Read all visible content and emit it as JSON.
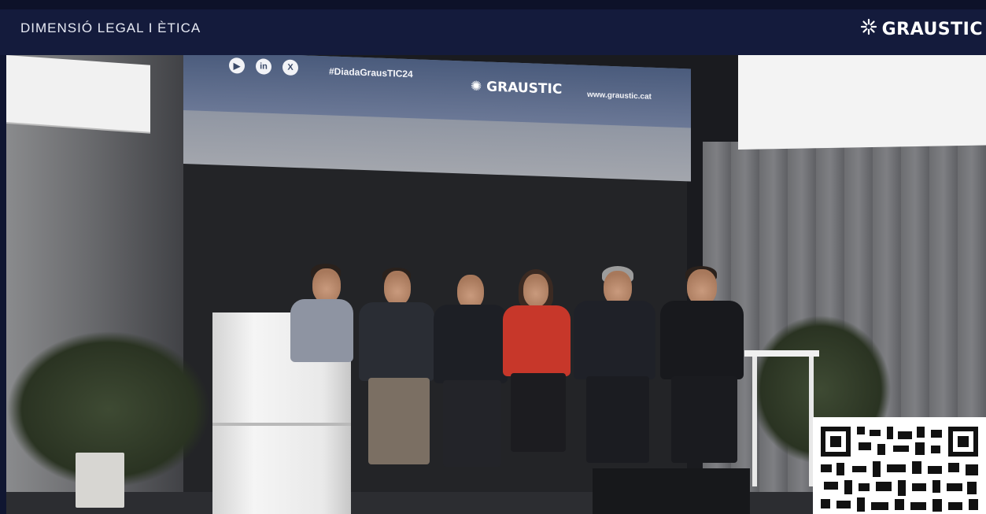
{
  "header": {
    "title": "DIMENSIÓ LEGAL I ÈTICA",
    "logo_text": "GRAUSTIC",
    "logo_icon": "spark-icon"
  },
  "video": {
    "screen": {
      "social_icons": [
        "youtube-icon",
        "linkedin-icon",
        "x-icon"
      ],
      "social_glyphs": [
        "▶",
        "in",
        "X"
      ],
      "hashtag": "#DiadaGrausTIC24",
      "logo_text": "GRAUSTIC",
      "url": "www.graustic.cat"
    }
  },
  "colors": {
    "header_bg": "#141b3c",
    "page_bg": "#101631",
    "header_text": "#e8ebf5"
  }
}
